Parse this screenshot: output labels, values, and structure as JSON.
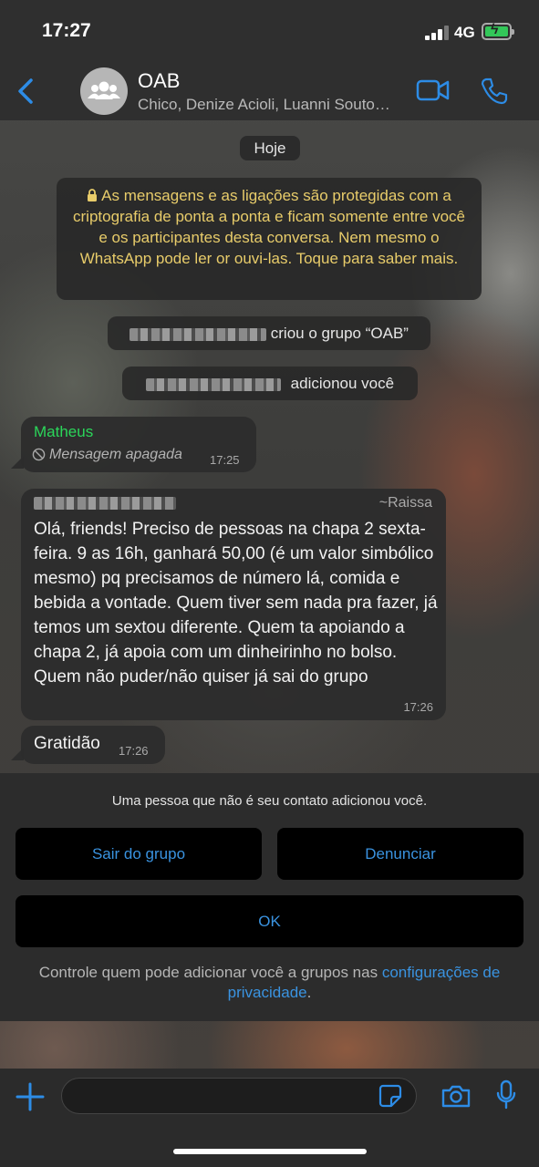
{
  "status_bar": {
    "time": "17:27",
    "network": "4G"
  },
  "header": {
    "title": "OAB",
    "members": "Chico, Denize Acioli, Luanni Souto…"
  },
  "chat": {
    "date_pill": "Hoje",
    "encryption_notice": "As mensagens e as ligações são protegidas com a criptografia de ponta a ponta e ficam somente entre você e os participantes desta conversa. Nem mesmo o WhatsApp pode ler or ouvi-las. Toque para saber mais.",
    "system_created": "criou o grupo “OAB”",
    "system_added": "adicionou você",
    "messages": [
      {
        "sender": "Matheus",
        "text": "Mensagem apagada",
        "time": "17:25"
      },
      {
        "sender_alias": "~Raissa",
        "text": "Olá, friends! Preciso de pessoas na chapa 2 sexta-feira. 9 as 16h, ganhará 50,00 (é um valor simbólico mesmo) pq precisamos de número lá, comida e bebida a vontade. Quem tiver sem nada pra fazer, já temos um sextou diferente. Quem ta apoiando a chapa 2, já apoia com um dinheirinho no bolso. Quem não puder/não quiser já sai do grupo",
        "time": "17:26"
      },
      {
        "text": "Gratidão",
        "time": "17:26"
      }
    ]
  },
  "sheet": {
    "info": "Uma pessoa que não é seu contato adicionou você.",
    "leave_label": "Sair do grupo",
    "report_label": "Denunciar",
    "ok_label": "OK",
    "privacy_text": "Controle quem pode adicionar você a grupos nas",
    "privacy_link": "configurações de privacidade",
    "privacy_end": "."
  },
  "icons": {
    "back": "chevron-left-icon",
    "avatar": "group-icon",
    "video": "video-camera-icon",
    "call": "phone-icon",
    "lock": "lock-icon",
    "deleted": "prohibited-icon",
    "plus": "plus-icon",
    "sticker": "sticker-icon",
    "camera": "camera-icon",
    "mic": "microphone-icon"
  },
  "colors": {
    "accent": "#2d8ce6",
    "sender_green": "#2bd65a",
    "notice_yellow": "#e8cc6a"
  }
}
